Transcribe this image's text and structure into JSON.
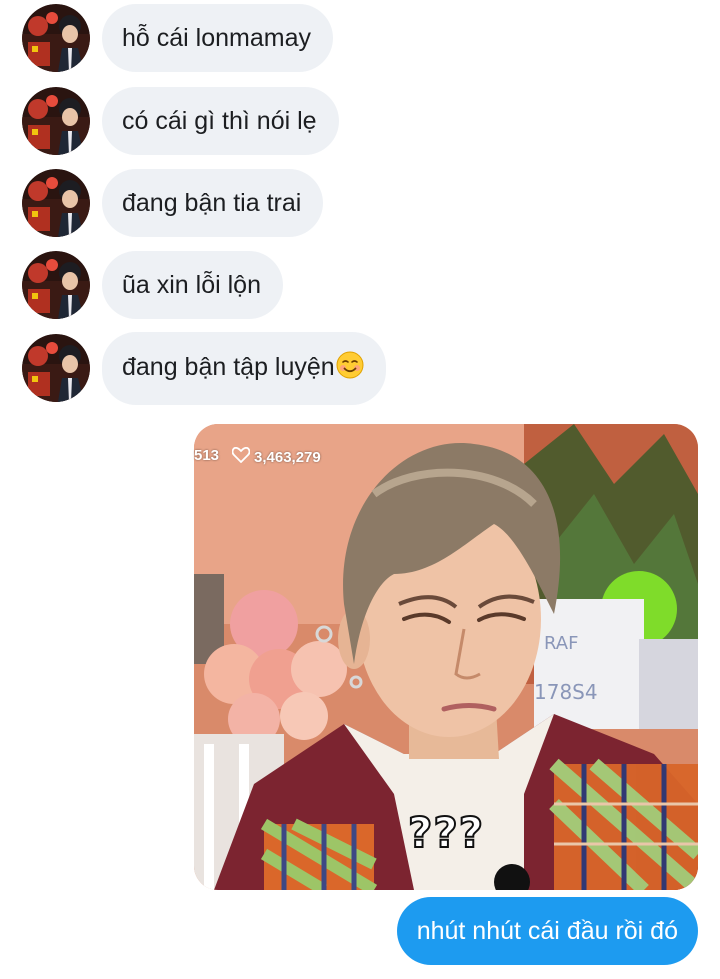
{
  "conversation": {
    "incoming": [
      {
        "text": "hỗ cái lonmamay"
      },
      {
        "text": "có cái gì thì nói lẹ"
      },
      {
        "text": "đang bận tia trai"
      },
      {
        "text": "ũa xin lỗi lộn"
      },
      {
        "text": "đang bận tập luyện",
        "emoji": "smiling-face-emoji"
      }
    ],
    "media": {
      "stats_left": "513",
      "likes": "3,463,279",
      "heart_icon": "heart-icon",
      "caption": "???"
    },
    "outgoing": [
      {
        "text": "nhút nhút cái đầu rồi đó"
      }
    ]
  },
  "colors": {
    "incoming_bubble": "#eef1f5",
    "outgoing_bubble": "#1d9bf0",
    "text_dark": "#1c1e21"
  }
}
